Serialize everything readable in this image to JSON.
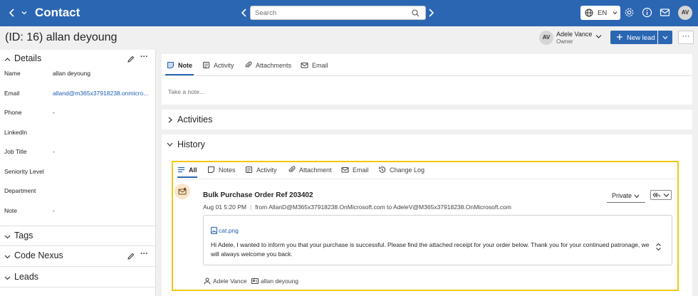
{
  "topbar": {
    "title": "Contact",
    "search_placeholder": "Search",
    "language": "EN",
    "user_initials": "AV"
  },
  "header": {
    "record_title": "(ID: 16) allan deyoung",
    "owner_initials": "AV",
    "owner_name": "Adele Vance",
    "owner_role": "Owner",
    "new_lead_label": "New lead",
    "more_label": "···"
  },
  "left": {
    "details_title": "Details",
    "fields": [
      {
        "label": "Name",
        "value": "allan deyoung"
      },
      {
        "label": "Email",
        "value": "alland@m365x37918238.onmicro..."
      },
      {
        "label": "Phone",
        "value": "-"
      },
      {
        "label": "LinkedIn",
        "value": ""
      },
      {
        "label": "Job Title",
        "value": "-"
      },
      {
        "label": "Seniority Level",
        "value": ""
      },
      {
        "label": "Department",
        "value": ""
      },
      {
        "label": "Note",
        "value": "-"
      }
    ],
    "tags_title": "Tags",
    "code_nexus_title": "Code Nexus",
    "leads_title": "Leads",
    "dots": "···"
  },
  "composer": {
    "tabs": [
      "Note",
      "Activity",
      "Attachments",
      "Email"
    ],
    "note_placeholder": "Take a note..."
  },
  "activities_title": "Activities",
  "history": {
    "title": "History",
    "tabs": [
      "All",
      "Notes",
      "Activity",
      "Attachment",
      "Email",
      "Change Log"
    ],
    "item": {
      "subject": "Bulk Purchase Order Ref 203402",
      "date": "Aug 01 5:20 PM",
      "route": "from AllanD@M365x37918238.OnMicrosoft.com to AdeleV@M365x37918238.OnMicrosoft.com",
      "privacy": "Private",
      "attachment": "cat.png",
      "body": "Hi Adele, I wanted to inform you that your purchase is successful. Please find the attached receipt for your order below. Thank you for your continued patronage, we will always welcome you back.",
      "sender": "Adele Vance",
      "recipient": "allan deyoung"
    }
  },
  "colors": {
    "brand": "#2b66b3",
    "highlight": "#f2c811",
    "link": "#1f5eb3"
  }
}
